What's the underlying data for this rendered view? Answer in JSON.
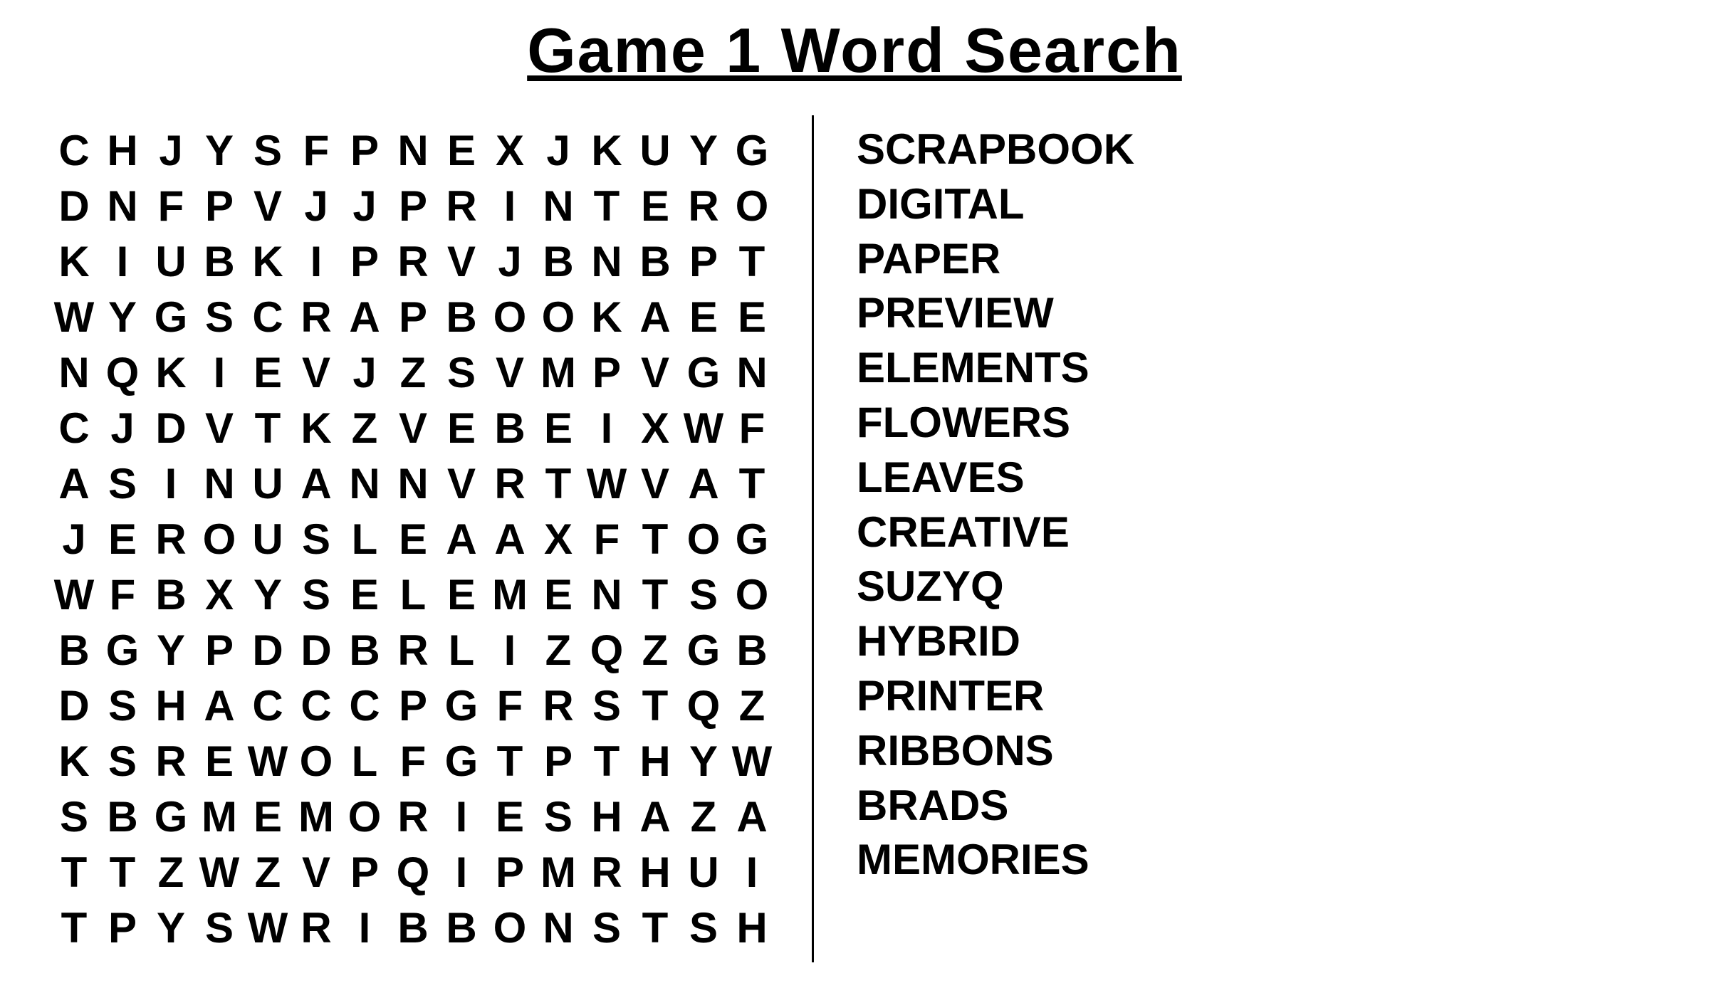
{
  "title": "Game 1 Word Search",
  "grid": [
    [
      "C",
      "H",
      "J",
      "Y",
      "S",
      "F",
      "P",
      "N",
      "E",
      "X",
      "J",
      "K",
      "U",
      "Y",
      "G"
    ],
    [
      "D",
      "N",
      "F",
      "P",
      "V",
      "J",
      "J",
      "P",
      "R",
      "I",
      "N",
      "T",
      "E",
      "R",
      "O"
    ],
    [
      "K",
      "I",
      "U",
      "B",
      "K",
      "I",
      "P",
      "R",
      "V",
      "J",
      "B",
      "N",
      "B",
      "P",
      "T"
    ],
    [
      "W",
      "Y",
      "G",
      "S",
      "C",
      "R",
      "A",
      "P",
      "B",
      "O",
      "O",
      "K",
      "A",
      "E",
      "E"
    ],
    [
      "N",
      "Q",
      "K",
      "I",
      "E",
      "V",
      "J",
      "Z",
      "S",
      "V",
      "M",
      "P",
      "V",
      "G",
      "N"
    ],
    [
      "C",
      "J",
      "D",
      "V",
      "T",
      "K",
      "Z",
      "V",
      "E",
      "B",
      "E",
      "I",
      "X",
      "W",
      "F"
    ],
    [
      "A",
      "S",
      "I",
      "N",
      "U",
      "A",
      "N",
      "N",
      "V",
      "R",
      "T",
      "W",
      "V",
      "A",
      "T"
    ],
    [
      "J",
      "E",
      "R",
      "O",
      "U",
      "S",
      "L",
      "E",
      "A",
      "A",
      "X",
      "F",
      "T",
      "O",
      "G"
    ],
    [
      "W",
      "F",
      "B",
      "X",
      "Y",
      "S",
      "E",
      "L",
      "E",
      "M",
      "E",
      "N",
      "T",
      "S",
      "O"
    ],
    [
      "B",
      "G",
      "Y",
      "P",
      "D",
      "D",
      "B",
      "R",
      "L",
      "I",
      "Z",
      "Q",
      "Z",
      "G",
      "B"
    ],
    [
      "D",
      "S",
      "H",
      "A",
      "C",
      "C",
      "C",
      "P",
      "G",
      "F",
      "R",
      "S",
      "T",
      "Q",
      "Z"
    ],
    [
      "K",
      "S",
      "R",
      "E",
      "W",
      "O",
      "L",
      "F",
      "G",
      "T",
      "P",
      "T",
      "H",
      "Y",
      "W"
    ],
    [
      "S",
      "B",
      "G",
      "M",
      "E",
      "M",
      "O",
      "R",
      "I",
      "E",
      "S",
      "H",
      "A",
      "Z",
      "A"
    ],
    [
      "T",
      "T",
      "Z",
      "W",
      "Z",
      "V",
      "P",
      "Q",
      "I",
      "P",
      "M",
      "R",
      "H",
      "U",
      "I"
    ],
    [
      "T",
      "P",
      "Y",
      "S",
      "W",
      "R",
      "I",
      "B",
      "B",
      "O",
      "N",
      "S",
      "T",
      "S",
      "H"
    ]
  ],
  "words": [
    "SCRAPBOOK",
    "DIGITAL",
    "PAPER",
    "PREVIEW",
    "ELEMENTS",
    "FLOWERS",
    "LEAVES",
    "CREATIVE",
    "SUZYQ",
    "HYBRID",
    "PRINTER",
    "RIBBONS",
    "BRADS",
    "MEMORIES"
  ]
}
